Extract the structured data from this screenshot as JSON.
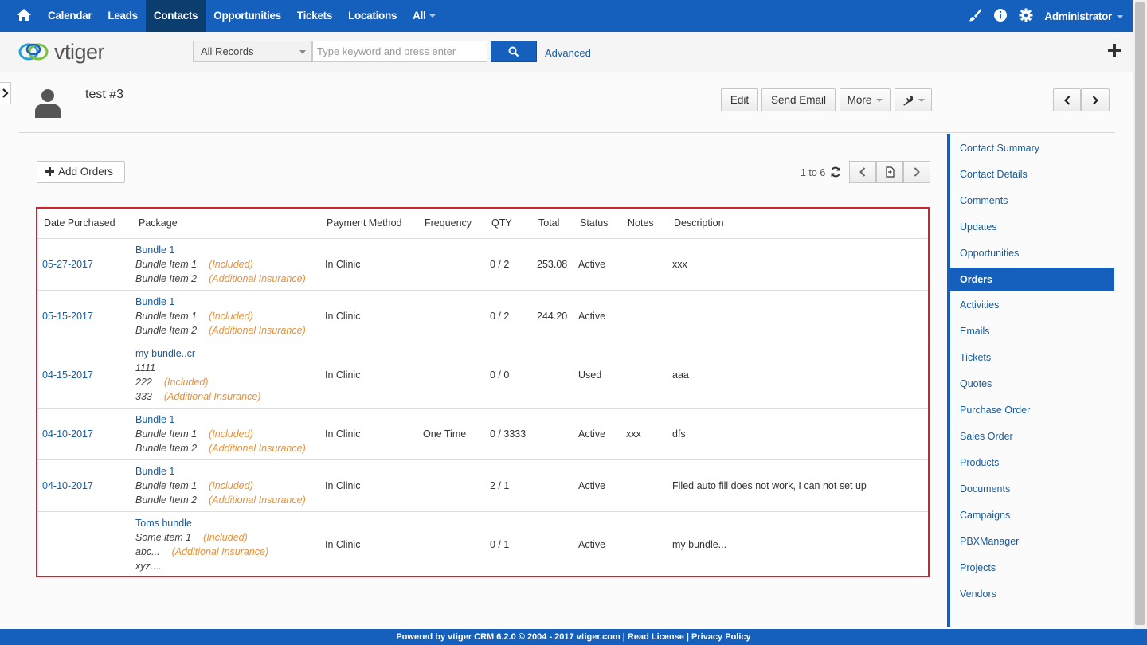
{
  "topnav": {
    "items": [
      "Calendar",
      "Leads",
      "Contacts",
      "Opportunities",
      "Tickets",
      "Locations",
      "All"
    ],
    "active": "Contacts",
    "user": "Administrator"
  },
  "header": {
    "logo_text": "vtiger",
    "select_value": "All Records",
    "search_placeholder": "Type keyword and press enter",
    "advanced_label": "Advanced"
  },
  "record": {
    "title": "test #3",
    "buttons": {
      "edit": "Edit",
      "send_email": "Send Email",
      "more": "More"
    }
  },
  "orders": {
    "add_label": "Add Orders",
    "pager_text": "1 to 6",
    "columns": [
      "Date Purchased",
      "Package",
      "Payment Method",
      "Frequency",
      "QTY",
      "Total",
      "Status",
      "Notes",
      "Description"
    ],
    "rows": [
      {
        "date": "05-27-2017",
        "package": "Bundle 1",
        "items": [
          {
            "name": "Bundle Item 1",
            "tag": "(Included)"
          },
          {
            "name": "Bundle Item 2",
            "tag": "(Additional Insurance)"
          }
        ],
        "payment": "In Clinic",
        "frequency": "",
        "qty": "0 / 2",
        "total": "253.08",
        "status": "Active",
        "notes": "",
        "description": "xxx"
      },
      {
        "date": "05-15-2017",
        "package": "Bundle 1",
        "items": [
          {
            "name": "Bundle Item 1",
            "tag": "(Included)"
          },
          {
            "name": "Bundle Item 2",
            "tag": "(Additional Insurance)"
          }
        ],
        "payment": "In Clinic",
        "frequency": "",
        "qty": "0 / 2",
        "total": "244.20",
        "status": "Active",
        "notes": "",
        "description": ""
      },
      {
        "date": "04-15-2017",
        "package": "my bundle..cr",
        "items": [
          {
            "name": "1111",
            "tag": ""
          },
          {
            "name": "222",
            "tag": "(Included)"
          },
          {
            "name": "333",
            "tag": "(Additional Insurance)"
          }
        ],
        "payment": "In Clinic",
        "frequency": "",
        "qty": "0 / 0",
        "total": "",
        "status": "Used",
        "notes": "",
        "description": "aaa"
      },
      {
        "date": "04-10-2017",
        "package": "Bundle 1",
        "items": [
          {
            "name": "Bundle Item 1",
            "tag": "(Included)"
          },
          {
            "name": "Bundle Item 2",
            "tag": "(Additional Insurance)"
          }
        ],
        "payment": "In Clinic",
        "frequency": "One Time",
        "qty": "0 / 3333",
        "total": "",
        "status": "Active",
        "notes": "xxx",
        "description": "dfs"
      },
      {
        "date": "04-10-2017",
        "package": "Bundle 1",
        "items": [
          {
            "name": "Bundle Item 1",
            "tag": "(Included)"
          },
          {
            "name": "Bundle Item 2",
            "tag": "(Additional Insurance)"
          }
        ],
        "payment": "In Clinic",
        "frequency": "",
        "qty": "2 / 1",
        "total": "",
        "status": "Active",
        "notes": "",
        "description": "Filed auto fill does not work, I can not set up"
      },
      {
        "date": "",
        "package": "Toms bundle",
        "items": [
          {
            "name": "Some item 1",
            "tag": "(Included)"
          },
          {
            "name": "abc...",
            "tag": "(Additional Insurance)"
          },
          {
            "name": "xyz....",
            "tag": ""
          }
        ],
        "payment": "In Clinic",
        "frequency": "",
        "qty": "0 / 1",
        "total": "",
        "status": "Active",
        "notes": "",
        "description": "my bundle..."
      }
    ]
  },
  "sidebar": {
    "items": [
      "Contact Summary",
      "Contact Details",
      "Comments",
      "Updates",
      "Opportunities",
      "Orders",
      "Activities",
      "Emails",
      "Tickets",
      "Quotes",
      "Purchase Order",
      "Sales Order",
      "Products",
      "Documents",
      "Campaigns",
      "PBXManager",
      "Projects",
      "Vendors"
    ],
    "active": "Orders"
  },
  "footer": {
    "text": "Powered by vtiger CRM 6.2.0  © 2004 - 2017  vtiger.com | Read License | Privacy Policy"
  },
  "colors": {
    "brand": "#1560bd",
    "highlight_border": "#d2222d",
    "tag": "#e69138"
  }
}
